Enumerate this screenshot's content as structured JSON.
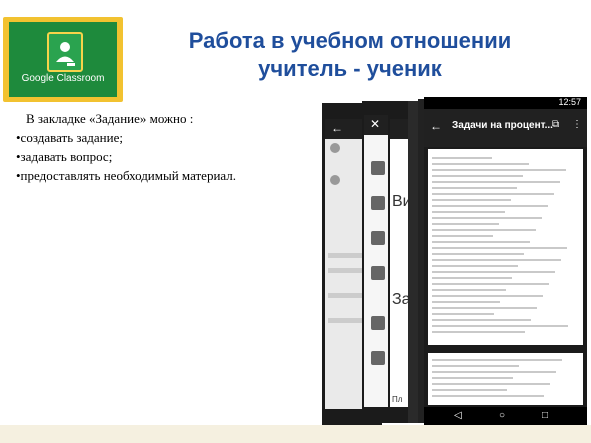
{
  "title": {
    "line1": "Работа в учебном отношении",
    "line2": "учитель - ученик"
  },
  "logo": {
    "text": "Google Classroom"
  },
  "body": {
    "heading": "В закладке «Задание» можно :",
    "bullets": [
      "•создавать задание;",
      "•задавать вопрос;",
      "•предоставлять необходимый материал."
    ]
  },
  "phones": {
    "front": {
      "time": "12:57",
      "header_title": "Задачи на процент..."
    },
    "side_labels": [
      "Вид",
      "Зад",
      "Пл"
    ]
  }
}
